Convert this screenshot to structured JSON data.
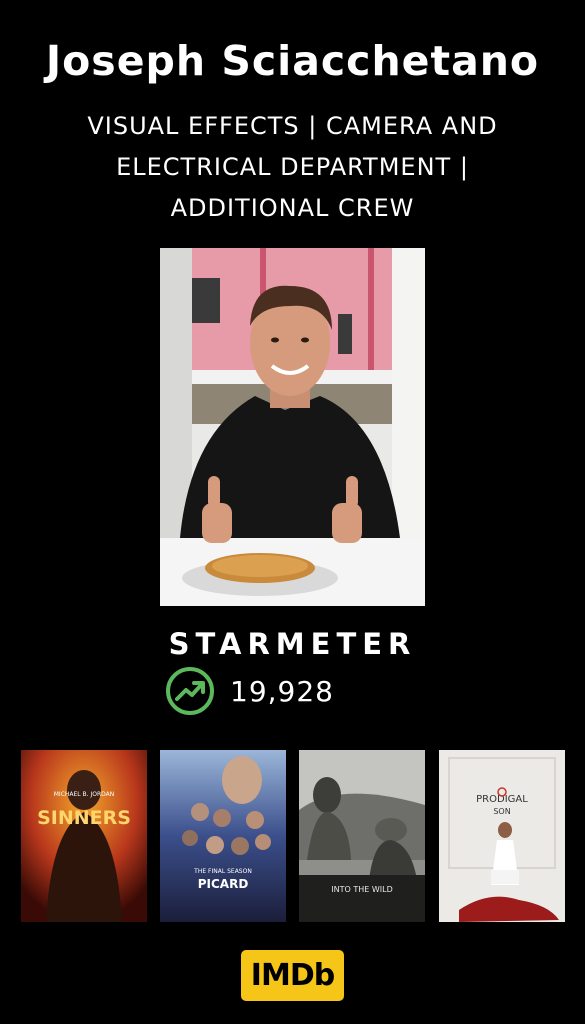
{
  "profile": {
    "name": "Joseph Sciacchetano",
    "roles_line1": "VISUAL EFFECTS | CAMERA AND",
    "roles_line2": "ELECTRICAL DEPARTMENT |",
    "roles_line3": "ADDITIONAL CREW"
  },
  "starmeter": {
    "label": "STARMETER",
    "value": "19,928",
    "trend_icon": "trending-up-icon",
    "icon_color": "#5cb85c"
  },
  "posters": {
    "sinners": {
      "title": "SINNERS",
      "credit": "MICHAEL B. JORDAN"
    },
    "picard": {
      "title": "PICARD",
      "credit": "THE FINAL SEASON"
    },
    "into_the_wild": {
      "title": "INTO THE WILD"
    },
    "prodigal_son": {
      "title": "PRODIGAL",
      "title_sub": "SON"
    }
  },
  "footer": {
    "logo_text": "IMDb",
    "logo_color": "#f5c518"
  }
}
